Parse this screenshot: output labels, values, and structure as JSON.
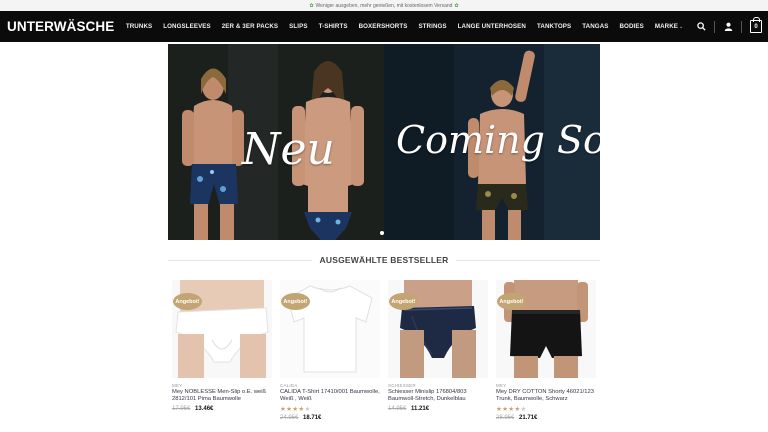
{
  "topbar": {
    "text": "Weniger ausgeben, mehr genießen, mit kostenlosem Versand",
    "icon": "leaf-icon"
  },
  "header": {
    "logo": "UNTERWÄSCHE",
    "nav": [
      "TRUNKS",
      "LONGSLEEVES",
      "2ER & 3ER PACKS",
      "SLIPS",
      "T-SHIRTS",
      "BOXERSHORTS",
      "STRINGS",
      "LANGE UNTERHOSEN",
      "TANKTOPS",
      "TANGAS",
      "BODIES",
      "MARKE"
    ],
    "cart_count": "0",
    "icons": [
      "search-icon",
      "account-icon",
      "cart-icon"
    ]
  },
  "hero": {
    "left_text": "Neu",
    "right_text": "Coming Soon",
    "slides": 1,
    "active_slide": 1
  },
  "section": {
    "title": "AUSGEWÄHLTE BESTSELLER"
  },
  "products": [
    {
      "badge": "Angebot!",
      "brand": "MEY",
      "name": "Mey NOBLESSE Men-Slip o.E. weiß 2812/101 Pima Baumwolle",
      "rating": 0,
      "old_price": "17.95€",
      "new_price": "13.46€"
    },
    {
      "badge": "Angebot!",
      "brand": "CALIDA",
      "name": "CALIDA T-Shirt 17410/001 Baumwolle, Weiß , Weiß",
      "rating": 4,
      "old_price": "24.95€",
      "new_price": "18.71€"
    },
    {
      "badge": "Angebot!",
      "brand": "SCHIESSER",
      "name": "Schiesser Minislip 176804/803 Baumwoll-Stretch, Dunkelblau",
      "rating": 0,
      "old_price": "14.95€",
      "new_price": "11.21€"
    },
    {
      "badge": "Angebot!",
      "brand": "MEY",
      "name": "Mey DRY COTTON Shorty 46021/123 Trunk, Baumwolle, Schwarz",
      "rating": 4,
      "old_price": "28.95€",
      "new_price": "21.71€"
    }
  ],
  "colors": {
    "header_bg": "#0b0b0b",
    "badge": "#c3a574",
    "stars": "#c3a574"
  }
}
